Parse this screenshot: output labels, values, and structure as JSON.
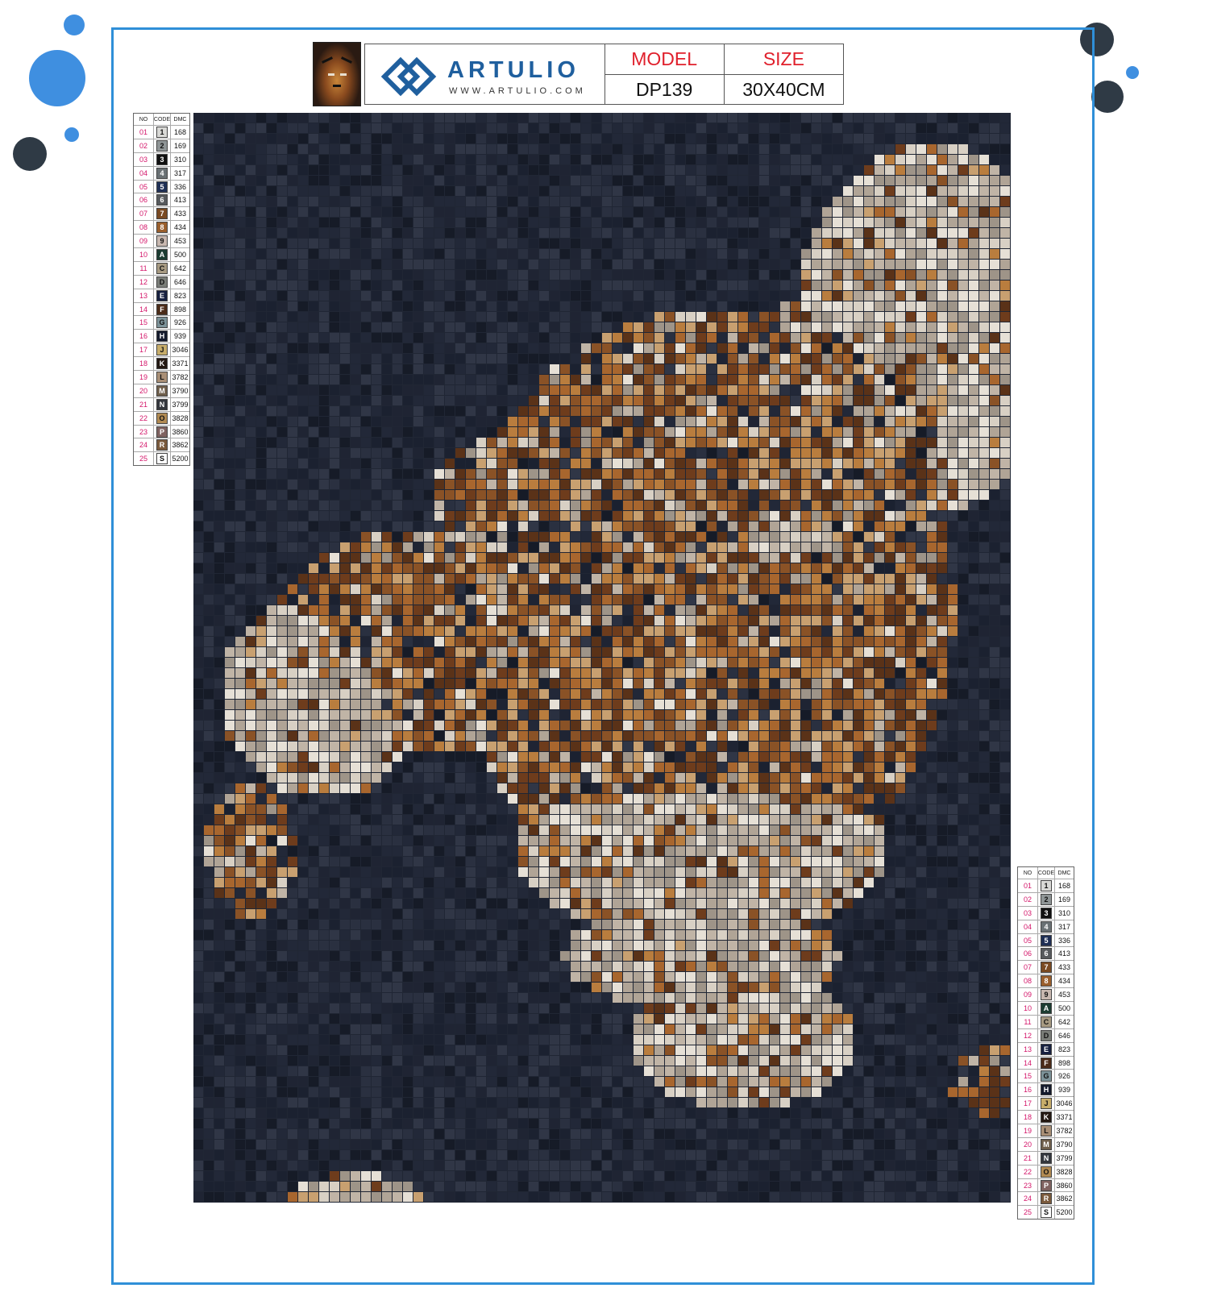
{
  "header": {
    "brand_name": "ARTULIO",
    "brand_url": "WWW.ARTULIO.COM",
    "model_label": "MODEL",
    "model_value": "DP139",
    "size_label": "SIZE",
    "size_value": "30X40CM"
  },
  "legend": {
    "col_no": "NO",
    "col_code": "CODE",
    "col_dmc": "DMC",
    "rows": [
      {
        "no": "01",
        "code": "1",
        "dmc": "168",
        "color": "#d9d9d6"
      },
      {
        "no": "02",
        "code": "2",
        "dmc": "169",
        "color": "#8f9596"
      },
      {
        "no": "03",
        "code": "3",
        "dmc": "310",
        "color": "#101010"
      },
      {
        "no": "04",
        "code": "4",
        "dmc": "317",
        "color": "#6a7174"
      },
      {
        "no": "05",
        "code": "5",
        "dmc": "336",
        "color": "#1f2f55"
      },
      {
        "no": "06",
        "code": "6",
        "dmc": "413",
        "color": "#575a5d"
      },
      {
        "no": "07",
        "code": "7",
        "dmc": "433",
        "color": "#7a4a22"
      },
      {
        "no": "08",
        "code": "8",
        "dmc": "434",
        "color": "#9a5f2d"
      },
      {
        "no": "09",
        "code": "9",
        "dmc": "453",
        "color": "#c8b8b0"
      },
      {
        "no": "10",
        "code": "A",
        "dmc": "500",
        "color": "#1c3c32"
      },
      {
        "no": "11",
        "code": "C",
        "dmc": "642",
        "color": "#a79a82"
      },
      {
        "no": "12",
        "code": "D",
        "dmc": "646",
        "color": "#7a7d78"
      },
      {
        "no": "13",
        "code": "E",
        "dmc": "823",
        "color": "#17203f"
      },
      {
        "no": "14",
        "code": "F",
        "dmc": "898",
        "color": "#4b2b18"
      },
      {
        "no": "15",
        "code": "G",
        "dmc": "926",
        "color": "#7c9298"
      },
      {
        "no": "16",
        "code": "H",
        "dmc": "939",
        "color": "#141a2c"
      },
      {
        "no": "17",
        "code": "J",
        "dmc": "3046",
        "color": "#c7ad6a"
      },
      {
        "no": "18",
        "code": "K",
        "dmc": "3371",
        "color": "#231812"
      },
      {
        "no": "19",
        "code": "L",
        "dmc": "3782",
        "color": "#a98f76"
      },
      {
        "no": "20",
        "code": "M",
        "dmc": "3790",
        "color": "#6f5f4c"
      },
      {
        "no": "21",
        "code": "N",
        "dmc": "3799",
        "color": "#34373d"
      },
      {
        "no": "22",
        "code": "O",
        "dmc": "3828",
        "color": "#b18a52"
      },
      {
        "no": "23",
        "code": "P",
        "dmc": "3860",
        "color": "#7f6260"
      },
      {
        "no": "24",
        "code": "R",
        "dmc": "3862",
        "color": "#7a5a3c"
      },
      {
        "no": "25",
        "code": "S",
        "dmc": "5200",
        "color": "#ffffff"
      }
    ]
  },
  "colors": {
    "frame": "#2f8fd8",
    "brand": "#1f5f9e",
    "label_red": "#e0202c",
    "legend_no": "#d4166a",
    "dot_blue": "#3f8fe0",
    "dot_dark": "#2f3a45"
  },
  "icons": {
    "logo": "artulio-diamond-logo",
    "thumbnail": "tiger-painting-thumbnail"
  }
}
